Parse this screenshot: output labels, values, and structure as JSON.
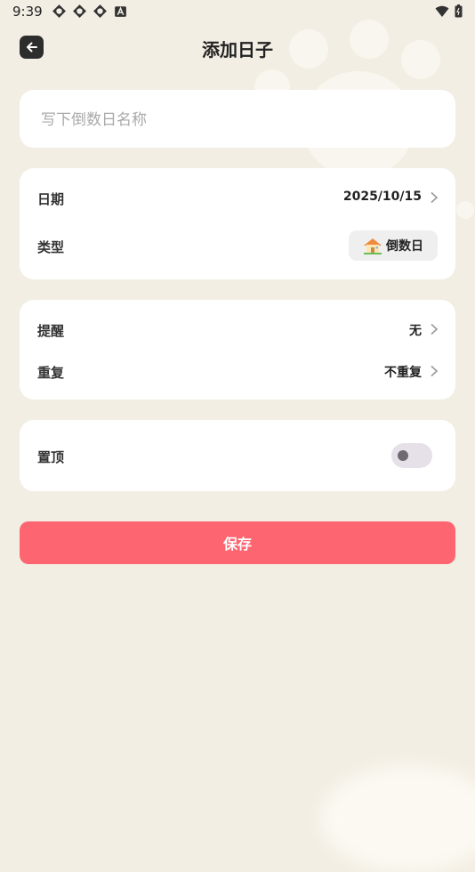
{
  "status_bar": {
    "time": "9:39"
  },
  "header": {
    "title": "添加日子",
    "back_icon": "arrow-left-icon"
  },
  "name_field": {
    "placeholder": "写下倒数日名称",
    "value": ""
  },
  "date_card": {
    "date_label": "日期",
    "date_value": "2025/10/15",
    "type_label": "类型",
    "type_value": "倒数日",
    "type_icon": "house-icon"
  },
  "remind_card": {
    "remind_label": "提醒",
    "remind_value": "无",
    "repeat_label": "重复",
    "repeat_value": "不重复"
  },
  "pin_card": {
    "label": "置顶",
    "enabled": false
  },
  "save_button": {
    "label": "保存"
  },
  "colors": {
    "background": "#f3eee3",
    "card": "#ffffff",
    "accent": "#fd6571",
    "toggle_off": "#e6e1e8"
  }
}
